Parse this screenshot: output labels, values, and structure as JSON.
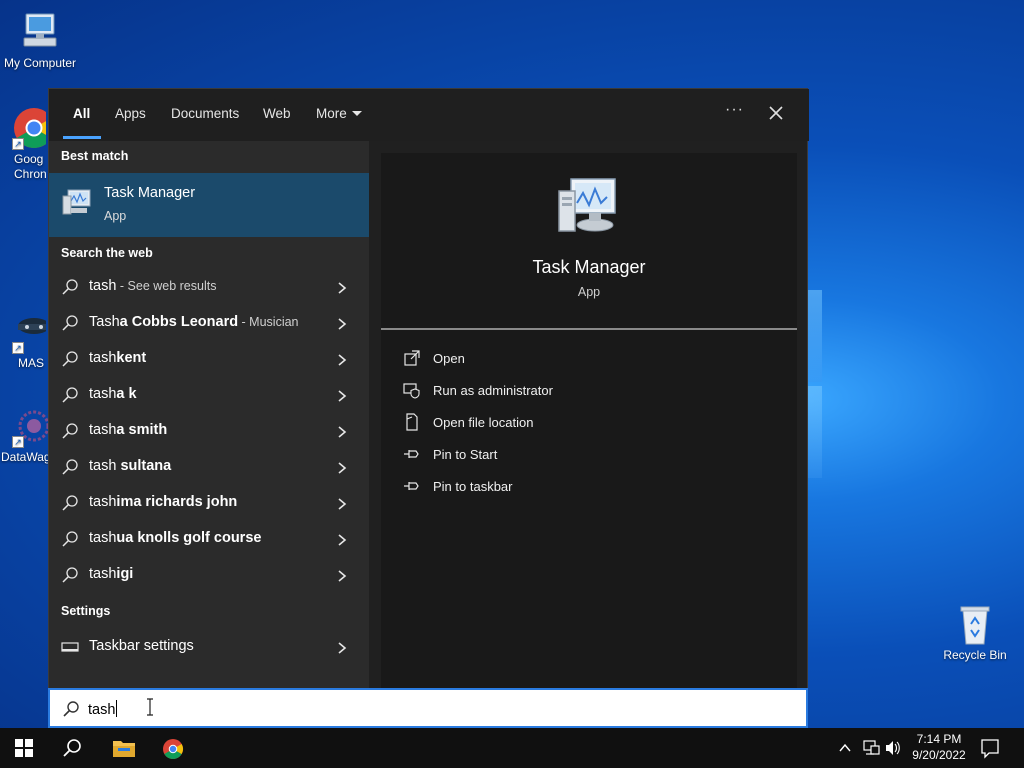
{
  "desktop": {
    "icons": [
      {
        "label": "My Computer"
      },
      {
        "label": "Goog\nChron"
      },
      {
        "label": "MAS"
      },
      {
        "label": "DataWag"
      },
      {
        "label": "Recycle Bin"
      }
    ]
  },
  "search": {
    "tabs": [
      {
        "label": "All",
        "active": true
      },
      {
        "label": "Apps"
      },
      {
        "label": "Documents"
      },
      {
        "label": "Web"
      },
      {
        "label": "More"
      }
    ],
    "best_match_heading": "Best match",
    "best_match": {
      "title": "Task Manager",
      "subtitle": "App"
    },
    "web_heading": "Search the web",
    "web_results": [
      {
        "prefix": "tash",
        "bold": "",
        "suffix": " - See web results"
      },
      {
        "prefix": "Tash",
        "bold": "a Cobbs Leonard",
        "suffix": " - Musician"
      },
      {
        "prefix": "tash",
        "bold": "kent",
        "suffix": ""
      },
      {
        "prefix": "tash",
        "bold": "a k",
        "suffix": ""
      },
      {
        "prefix": "tash",
        "bold": "a smith",
        "suffix": ""
      },
      {
        "prefix": "tash",
        "bold": " sultana",
        "suffix": ""
      },
      {
        "prefix": "tash",
        "bold": "ima richards john",
        "suffix": ""
      },
      {
        "prefix": "tash",
        "bold": "ua knolls golf course",
        "suffix": ""
      },
      {
        "prefix": "tash",
        "bold": "igi",
        "suffix": ""
      }
    ],
    "settings_heading": "Settings",
    "settings_results": [
      {
        "label": "Taskbar settings"
      }
    ],
    "preview": {
      "title": "Task Manager",
      "subtitle": "App",
      "actions": [
        {
          "label": "Open",
          "icon": "open-icon"
        },
        {
          "label": "Run as administrator",
          "icon": "shield-icon"
        },
        {
          "label": "Open file location",
          "icon": "file-location-icon"
        },
        {
          "label": "Pin to Start",
          "icon": "pin-icon"
        },
        {
          "label": "Pin to taskbar",
          "icon": "pin-icon"
        }
      ]
    },
    "query": "tash"
  },
  "taskbar": {
    "time": "7:14 PM",
    "date": "9/20/2022"
  },
  "colors": {
    "accent": "#4aa3ff",
    "best_match_bg": "#1b4a6b",
    "panel_bg": "#202020"
  }
}
